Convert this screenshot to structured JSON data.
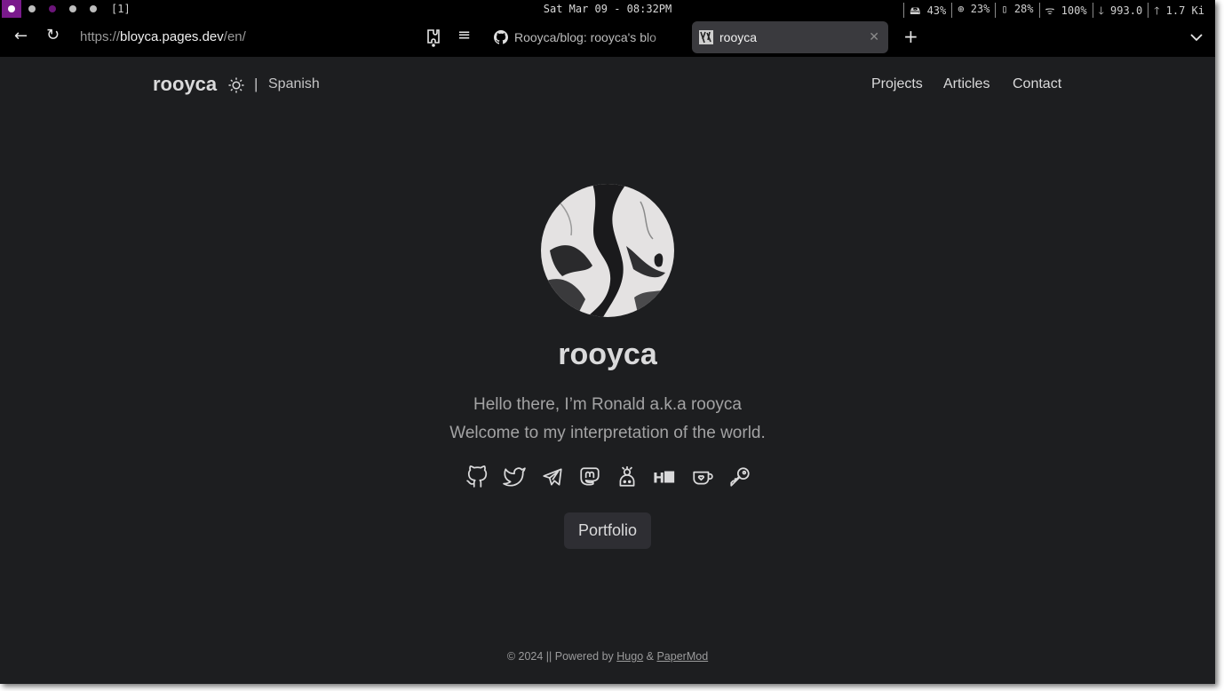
{
  "statusbar": {
    "workspace_label": "[1]",
    "clock": "Sat Mar 09 - 08:32PM",
    "stats": [
      "🖴 43%",
      "⊕ 23%",
      "▯ 28%",
      "ᯤ 100%",
      "🡓 993.0",
      "🡑 1.7 Ki"
    ]
  },
  "browser": {
    "url_prefix": "https://",
    "url_host": "bloyca.pages.dev",
    "url_path": "/en/",
    "tabs": [
      {
        "label": "Rooyca/blog: rooyca's blo"
      },
      {
        "label": "rooyca"
      }
    ],
    "close_glyph": "✕",
    "new_tab_glyph": "+",
    "back_glyph": "←",
    "reload_glyph": "↻",
    "menu_glyph": "≡",
    "dropdown_glyph": "⌄"
  },
  "header": {
    "logo": "rooyca",
    "separator": "|",
    "language": "Spanish",
    "nav": [
      "Projects",
      "Articles",
      "Contact"
    ]
  },
  "profile": {
    "name": "rooyca",
    "subtitle_line1": "Hello there, I’m Ronald a.k.a rooyca",
    "subtitle_line2": "Welcome to my interpretation of the world.",
    "socials": [
      "github-icon",
      "twitter-icon",
      "telegram-icon",
      "mastodon-icon",
      "cloud-person-icon",
      "hn-icon",
      "kofi-icon",
      "key-icon"
    ],
    "button_label": "Portfolio"
  },
  "footer": {
    "prefix": "© 2024  ||  Powered by",
    "hugo": "Hugo",
    "amp": "&",
    "papermod": "PaperMod"
  },
  "colors": {
    "page_bg": "#1d1e20",
    "primary_text": "#dadadb",
    "secondary_text": "#a3a3a4",
    "button_bg": "#2e2e33",
    "workspace_active": "#7a1a8c"
  }
}
